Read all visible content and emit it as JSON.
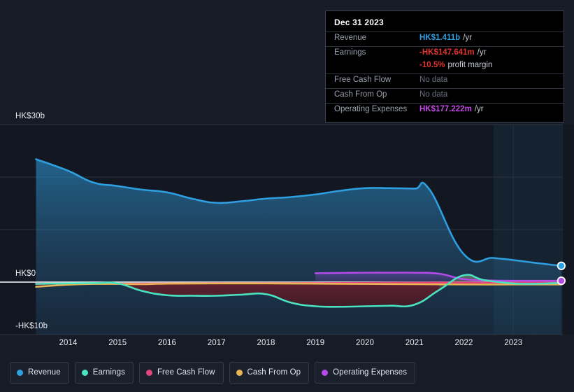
{
  "tooltip": {
    "title": "Dec 31 2023",
    "rows": [
      {
        "key": "Revenue",
        "value": "HK$1.411b",
        "unit": "/yr",
        "color": "#2e9fe0",
        "nodata": false
      },
      {
        "key": "Earnings",
        "value": "-HK$147.641m",
        "unit": "/yr",
        "color": "#e0352e",
        "nodata": false
      },
      {
        "key": "",
        "value": "-10.5%",
        "unit": "profit margin",
        "color": "#e0352e",
        "nodata": false,
        "sub": true
      },
      {
        "key": "Free Cash Flow",
        "value": "No data",
        "unit": "",
        "color": "#6a717e",
        "nodata": true
      },
      {
        "key": "Cash From Op",
        "value": "No data",
        "unit": "",
        "color": "#6a717e",
        "nodata": true
      },
      {
        "key": "Operating Expenses",
        "value": "HK$177.222m",
        "unit": "/yr",
        "color": "#c44ae8",
        "nodata": false
      }
    ]
  },
  "legend": {
    "items": [
      {
        "label": "Revenue",
        "color": "#2e9fe0"
      },
      {
        "label": "Earnings",
        "color": "#4ae3c0"
      },
      {
        "label": "Free Cash Flow",
        "color": "#e0457b"
      },
      {
        "label": "Cash From Op",
        "color": "#eab455"
      },
      {
        "label": "Operating Expenses",
        "color": "#b44ae8"
      }
    ]
  },
  "axes": {
    "y_ticks": [
      {
        "label": "HK$30b",
        "value": 30
      },
      {
        "label": "HK$0",
        "value": 0
      },
      {
        "label": "-HK$10b",
        "value": -10
      }
    ],
    "x_ticks": [
      "2014",
      "2015",
      "2016",
      "2017",
      "2018",
      "2019",
      "2020",
      "2021",
      "2022",
      "2023"
    ]
  },
  "chart_data": {
    "type": "line",
    "title": "",
    "xlabel": "",
    "ylabel": "HK$",
    "ylim": [
      -10,
      30
    ],
    "xlim": [
      2013.3,
      2024.0
    ],
    "grid": true,
    "legend_position": "bottom",
    "zero_line": true,
    "y_tick_values": [
      30,
      20,
      10,
      0,
      -10
    ],
    "y_tick_labels": [
      "HK$30b",
      "",
      "",
      "HK$0",
      "-HK$10b"
    ],
    "x_tick_values": [
      2014,
      2015,
      2016,
      2017,
      2018,
      2019,
      2020,
      2021,
      2022,
      2023
    ],
    "units": "HK$ billions",
    "forecast_band_start": 2022.6,
    "series": [
      {
        "name": "Revenue",
        "color": "#2e9fe0",
        "filled": true,
        "x": [
          2013.35,
          2014.0,
          2014.5,
          2015.0,
          2015.5,
          2016.0,
          2016.5,
          2017.0,
          2017.5,
          2018.0,
          2018.5,
          2019.0,
          2019.5,
          2020.0,
          2020.5,
          2021.0,
          2021.3,
          2022.0,
          2022.6,
          2023.0,
          2023.5,
          2023.97
        ],
        "y": [
          23.4,
          21.2,
          19.0,
          18.3,
          17.6,
          17.1,
          15.9,
          15.1,
          15.4,
          15.9,
          16.2,
          16.7,
          17.4,
          17.9,
          17.9,
          17.8,
          17.7,
          5.3,
          4.6,
          4.2,
          3.6,
          3.1
        ]
      },
      {
        "name": "Earnings",
        "color": "#4ae3c0",
        "filled": false,
        "x": [
          2013.35,
          2014.0,
          2014.5,
          2015.0,
          2015.5,
          2016.0,
          2016.5,
          2017.0,
          2017.5,
          2018.0,
          2018.5,
          2019.0,
          2019.5,
          2020.0,
          2020.5,
          2021.0,
          2021.5,
          2022.0,
          2022.4,
          2023.0,
          2023.5,
          2023.97
        ],
        "y": [
          -0.35,
          -0.25,
          -0.2,
          -0.25,
          -1.7,
          -2.5,
          -2.6,
          -2.6,
          -2.4,
          -2.3,
          -3.9,
          -4.6,
          -4.7,
          -4.6,
          -4.5,
          -4.3,
          -1.5,
          1.3,
          0.4,
          -0.25,
          -0.3,
          -0.15
        ]
      },
      {
        "name": "Free Cash Flow",
        "color": "#e0457b",
        "filled": false,
        "x": [
          2013.35,
          2015.0,
          2017.0,
          2019.0,
          2020.0,
          2021.0,
          2022.0,
          2023.0,
          2023.97
        ],
        "y": [
          -0.3,
          -0.3,
          -0.2,
          -0.2,
          -0.15,
          -0.1,
          -0.1,
          -0.1,
          -0.1
        ]
      },
      {
        "name": "Cash From Op",
        "color": "#eab455",
        "filled": false,
        "x": [
          2013.35,
          2014.0,
          2014.5,
          2015.0,
          2015.5,
          2016.0,
          2017.0,
          2018.0,
          2019.0,
          2020.0,
          2021.0,
          2022.0,
          2023.0,
          2023.97
        ],
        "y": [
          -0.9,
          -0.5,
          -0.35,
          -0.35,
          -0.4,
          -0.3,
          -0.25,
          -0.25,
          -0.3,
          -0.35,
          -0.4,
          -0.45,
          -0.45,
          -0.45
        ]
      },
      {
        "name": "Operating Expenses",
        "color": "#b44ae8",
        "filled": false,
        "x": [
          2019.0,
          2019.5,
          2020.0,
          2020.5,
          2021.0,
          2021.5,
          2022.0,
          2022.6,
          2023.0,
          2023.97
        ],
        "y": [
          1.7,
          1.75,
          1.8,
          1.8,
          1.8,
          1.6,
          0.55,
          0.3,
          0.25,
          0.25
        ]
      }
    ],
    "endpoint_markers": [
      {
        "series": "Revenue",
        "x": 2023.97,
        "y": 3.1,
        "color": "#2e9fe0"
      },
      {
        "series": "Operating Expenses",
        "x": 2023.97,
        "y": 0.25,
        "color": "#b44ae8"
      }
    ]
  }
}
